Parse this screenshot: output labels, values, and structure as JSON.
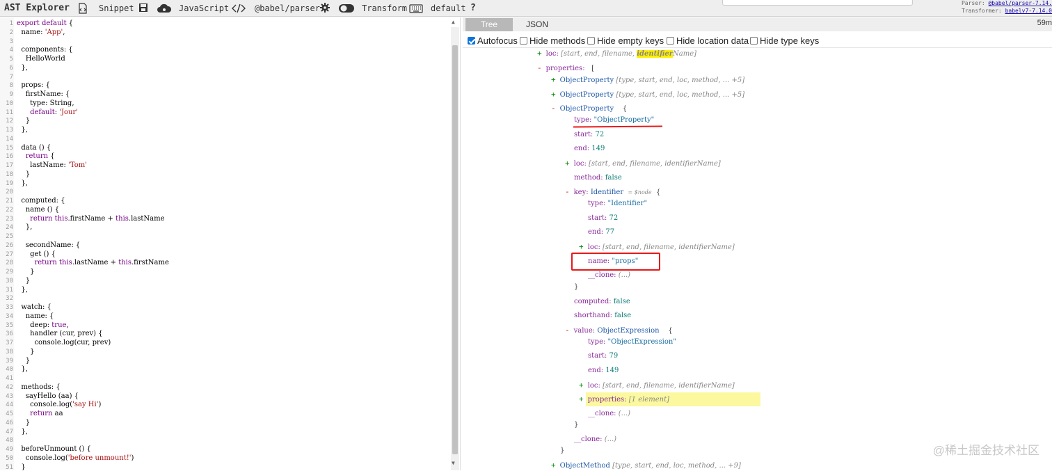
{
  "toolbar": {
    "app_title": "AST Explorer",
    "snippet_label": "Snippet",
    "language_label": "JavaScript",
    "parser_label": "@babel/parser",
    "transform_label": "Transform",
    "keymap_label": "default",
    "help_label": "?"
  },
  "meta": {
    "parser_prefix": "Parser:",
    "parser_value": "@babel/parser-7.14.",
    "transformer_prefix": "Transformer:",
    "transformer_value": "babelv7-7.14.0"
  },
  "editor": {
    "line_numbers": [
      "1",
      "2",
      "3",
      "4",
      "5",
      "6",
      "7",
      "8",
      "9",
      "10",
      "11",
      "12",
      "13",
      "14",
      "15",
      "16",
      "17",
      "18",
      "19",
      "20",
      "21",
      "22",
      "23",
      "24",
      "25",
      "26",
      "27",
      "28",
      "29",
      "30",
      "31",
      "32",
      "33",
      "34",
      "35",
      "36",
      "37",
      "38",
      "39",
      "40",
      "41",
      "42",
      "43",
      "44",
      "45",
      "46",
      "47",
      "48",
      "49",
      "50",
      "51"
    ],
    "code": [
      "export default {",
      "  name: 'App',",
      "",
      "  components: {",
      "    HelloWorld",
      "  },",
      "",
      "  props: {",
      "    firstName: {",
      "      type: String,",
      "      default: 'Jour'",
      "    }",
      "  },",
      "",
      "  data () {",
      "    return {",
      "      lastName: 'Tom'",
      "    }",
      "  },",
      "",
      "  computed: {",
      "    name () {",
      "      return this.firstName + this.lastName",
      "    },",
      "",
      "    secondName: {",
      "      get () {",
      "        return this.lastName + this.firstName",
      "      }",
      "    }",
      "  },",
      "",
      "  watch: {",
      "    name: {",
      "      deep: true,",
      "      handler (cur, prev) {",
      "        console.log(cur, prev)",
      "      }",
      "    }",
      "  },",
      "",
      "  methods: {",
      "    sayHello (aa) {",
      "      console.log('say Hi')",
      "      return aa",
      "    }",
      "  },",
      "",
      "  beforeUnmount () {",
      "    console.log('before unmount!')",
      "  }"
    ]
  },
  "tabs": {
    "tree": "Tree",
    "json": "JSON"
  },
  "timing": "59m",
  "options": {
    "autofocus": "Autofocus",
    "hide_methods": "Hide methods",
    "hide_empty_keys": "Hide empty keys",
    "hide_location_data": "Hide location data",
    "hide_type_keys": "Hide type keys",
    "autofocus_checked": true
  },
  "tree": {
    "loc_key": "loc:",
    "loc_summary_a": "[start, end, filename, ",
    "loc_summary_hl": "identifier",
    "loc_summary_b": "Name]",
    "properties_key": "properties:",
    "open_bracket": "[",
    "obj_prop_label": "ObjectProperty",
    "obj_prop_summary": "[type, start, end, loc, method, ... +5]",
    "open_brace": "{",
    "type_key": "type:",
    "type_val_objprop": "\"ObjectProperty\"",
    "start_key": "start:",
    "end_key": "end:",
    "start_72": "72",
    "end_149": "149",
    "loc_summary": "[start, end, filename, identifierName]",
    "method_key": "method:",
    "false_val": "false",
    "key_key": "key:",
    "identifier_label": "Identifier",
    "node_hint": "= $node",
    "type_val_identifier": "\"Identifier\"",
    "end_77": "77",
    "name_key": "name:",
    "name_val": "\"props\"",
    "clone_key": "__clone:",
    "clone_val": "(...)",
    "close_brace": "}",
    "computed_key": "computed:",
    "shorthand_key": "shorthand:",
    "value_key": "value:",
    "objexpr_label": "ObjectExpression",
    "type_val_objexpr": "\"ObjectExpression\"",
    "start_79": "79",
    "inner_properties_summary": "[1 element]",
    "close_bracket": "]",
    "obj_method_label": "ObjectMethod",
    "obj_method_summary": "[type, start, end, loc, method, ... +9]"
  },
  "watermark": "@稀土掘金技术社区"
}
